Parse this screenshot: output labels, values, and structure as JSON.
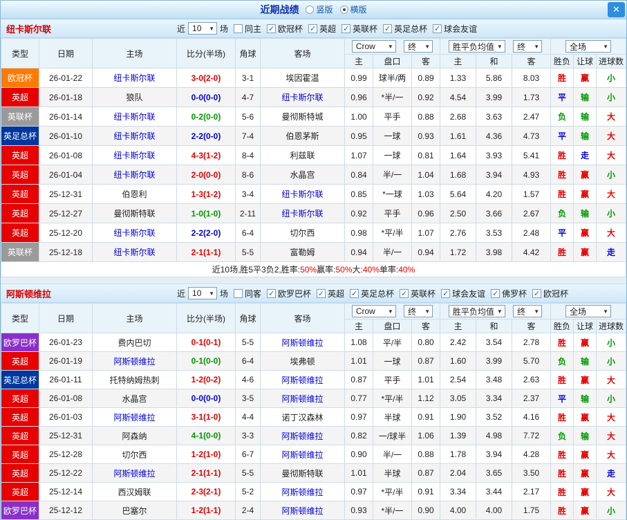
{
  "titlebar": {
    "title": "近期战绩",
    "radio_options": [
      {
        "label": "竖版",
        "selected": false
      },
      {
        "label": "横版",
        "selected": true
      }
    ]
  },
  "icons": {
    "check": "✓",
    "close": "✕",
    "dropdown_arrow": "▼"
  },
  "type_colors": {
    "欧冠杯": "#ff7a00",
    "英超": "#e60000",
    "英联杯": "#9a9a9a",
    "英足总杯": "#00379e",
    "欧罗巴杯": "#8a2fc9"
  },
  "table_header": {
    "cols": [
      "类型",
      "日期",
      "主场",
      "比分(半场)",
      "角球",
      "客场"
    ],
    "sub": [
      "主",
      "盘口",
      "客",
      "主",
      "和",
      "客",
      "胜负",
      "让球",
      "进球数"
    ],
    "bookmaker": "Crow",
    "period": "终",
    "avg_label": "胜平负均值",
    "scope": "全场"
  },
  "sections": [
    {
      "team": "纽卡斯尔联",
      "filter": {
        "near_label": "近",
        "count": "10",
        "games_label": "场",
        "same": {
          "label": "同主",
          "checked": false
        },
        "leagues": [
          {
            "label": "欧冠杯",
            "checked": true
          },
          {
            "label": "英超",
            "checked": true
          },
          {
            "label": "英联杯",
            "checked": true
          },
          {
            "label": "英足总杯",
            "checked": true
          },
          {
            "label": "球会友谊",
            "checked": true
          }
        ]
      },
      "rows": [
        {
          "type": "欧冠杯",
          "date": "26-01-22",
          "home": "纽卡斯尔联",
          "home_focus": true,
          "score": "3-0(2-0)",
          "score_c": "w",
          "corner": "3-1",
          "away": "埃因霍温",
          "away_focus": false,
          "odds": [
            "0.99",
            "球半/两",
            "0.89"
          ],
          "avg": [
            "1.33",
            "5.86",
            "8.03"
          ],
          "res": [
            {
              "t": "胜",
              "c": "w"
            },
            {
              "t": "赢",
              "c": "w"
            },
            {
              "t": "小",
              "c": "l"
            }
          ]
        },
        {
          "type": "英超",
          "date": "26-01-18",
          "home": "狼队",
          "home_focus": false,
          "score": "0-0(0-0)",
          "score_c": "d",
          "corner": "4-7",
          "away": "纽卡斯尔联",
          "away_focus": true,
          "odds": [
            "0.96",
            "*半/一",
            "0.92"
          ],
          "avg": [
            "4.54",
            "3.99",
            "1.73"
          ],
          "res": [
            {
              "t": "平",
              "c": "d"
            },
            {
              "t": "输",
              "c": "l"
            },
            {
              "t": "小",
              "c": "l"
            }
          ]
        },
        {
          "type": "英联杯",
          "date": "26-01-14",
          "home": "纽卡斯尔联",
          "home_focus": true,
          "score": "0-2(0-0)",
          "score_c": "l",
          "corner": "5-6",
          "away": "曼彻斯特城",
          "away_focus": false,
          "odds": [
            "1.00",
            "平手",
            "0.88"
          ],
          "avg": [
            "2.68",
            "3.63",
            "2.47"
          ],
          "res": [
            {
              "t": "负",
              "c": "l"
            },
            {
              "t": "输",
              "c": "l"
            },
            {
              "t": "大",
              "c": "w"
            }
          ]
        },
        {
          "type": "英足总杯",
          "date": "26-01-10",
          "home": "纽卡斯尔联",
          "home_focus": true,
          "score": "2-2(0-0)",
          "score_c": "d",
          "corner": "7-4",
          "away": "伯恩茅斯",
          "away_focus": false,
          "odds": [
            "0.95",
            "一球",
            "0.93"
          ],
          "avg": [
            "1.61",
            "4.36",
            "4.73"
          ],
          "res": [
            {
              "t": "平",
              "c": "d"
            },
            {
              "t": "输",
              "c": "l"
            },
            {
              "t": "大",
              "c": "w"
            }
          ]
        },
        {
          "type": "英超",
          "date": "26-01-08",
          "home": "纽卡斯尔联",
          "home_focus": true,
          "score": "4-3(1-2)",
          "score_c": "w",
          "corner": "8-4",
          "away": "利兹联",
          "away_focus": false,
          "odds": [
            "1.07",
            "一球",
            "0.81"
          ],
          "avg": [
            "1.64",
            "3.93",
            "5.41"
          ],
          "res": [
            {
              "t": "胜",
              "c": "w"
            },
            {
              "t": "走",
              "c": "d"
            },
            {
              "t": "大",
              "c": "w"
            }
          ]
        },
        {
          "type": "英超",
          "date": "26-01-04",
          "home": "纽卡斯尔联",
          "home_focus": true,
          "score": "2-0(0-0)",
          "score_c": "w",
          "corner": "8-6",
          "away": "水晶宫",
          "away_focus": false,
          "odds": [
            "0.84",
            "半/一",
            "1.04"
          ],
          "avg": [
            "1.68",
            "3.94",
            "4.93"
          ],
          "res": [
            {
              "t": "胜",
              "c": "w"
            },
            {
              "t": "赢",
              "c": "w"
            },
            {
              "t": "小",
              "c": "l"
            }
          ]
        },
        {
          "type": "英超",
          "date": "25-12-31",
          "home": "伯恩利",
          "home_focus": false,
          "score": "1-3(1-2)",
          "score_c": "w",
          "corner": "3-4",
          "away": "纽卡斯尔联",
          "away_focus": true,
          "odds": [
            "0.85",
            "*一球",
            "1.03"
          ],
          "avg": [
            "5.64",
            "4.20",
            "1.57"
          ],
          "res": [
            {
              "t": "胜",
              "c": "w"
            },
            {
              "t": "赢",
              "c": "w"
            },
            {
              "t": "大",
              "c": "w"
            }
          ]
        },
        {
          "type": "英超",
          "date": "25-12-27",
          "home": "曼彻斯特联",
          "home_focus": false,
          "score": "1-0(1-0)",
          "score_c": "l",
          "corner": "2-11",
          "away": "纽卡斯尔联",
          "away_focus": true,
          "odds": [
            "0.92",
            "平手",
            "0.96"
          ],
          "avg": [
            "2.50",
            "3.66",
            "2.67"
          ],
          "res": [
            {
              "t": "负",
              "c": "l"
            },
            {
              "t": "输",
              "c": "l"
            },
            {
              "t": "小",
              "c": "l"
            }
          ]
        },
        {
          "type": "英超",
          "date": "25-12-20",
          "home": "纽卡斯尔联",
          "home_focus": true,
          "score": "2-2(2-0)",
          "score_c": "d",
          "corner": "6-4",
          "away": "切尔西",
          "away_focus": false,
          "odds": [
            "0.98",
            "*平/半",
            "1.07"
          ],
          "avg": [
            "2.76",
            "3.53",
            "2.48"
          ],
          "res": [
            {
              "t": "平",
              "c": "d"
            },
            {
              "t": "赢",
              "c": "w"
            },
            {
              "t": "大",
              "c": "w"
            }
          ]
        },
        {
          "type": "英联杯",
          "date": "25-12-18",
          "home": "纽卡斯尔联",
          "home_focus": true,
          "score": "2-1(1-1)",
          "score_c": "w",
          "corner": "5-5",
          "away": "富勒姆",
          "away_focus": false,
          "odds": [
            "0.94",
            "半/一",
            "0.94"
          ],
          "avg": [
            "1.72",
            "3.98",
            "4.42"
          ],
          "res": [
            {
              "t": "胜",
              "c": "w"
            },
            {
              "t": "赢",
              "c": "w"
            },
            {
              "t": "走",
              "c": "d"
            }
          ]
        }
      ],
      "summary": {
        "parts": [
          {
            "t": "近10场,胜5平3负2, ",
            "c": ""
          },
          {
            "t": "胜率:",
            "c": ""
          },
          {
            "t": "50%",
            "c": "w"
          },
          {
            "t": " 赢率:",
            "c": ""
          },
          {
            "t": "50%",
            "c": "w"
          },
          {
            "t": " 大:",
            "c": ""
          },
          {
            "t": "40%",
            "c": "w"
          },
          {
            "t": " 单率:",
            "c": ""
          },
          {
            "t": "40%",
            "c": "w"
          }
        ]
      }
    },
    {
      "team": "阿斯顿维拉",
      "filter": {
        "near_label": "近",
        "count": "10",
        "games_label": "场",
        "same": {
          "label": "同客",
          "checked": false
        },
        "leagues": [
          {
            "label": "欧罗巴杯",
            "checked": true
          },
          {
            "label": "英超",
            "checked": true
          },
          {
            "label": "英足总杯",
            "checked": true
          },
          {
            "label": "英联杯",
            "checked": true
          },
          {
            "label": "球会友谊",
            "checked": true
          },
          {
            "label": "佛罗杯",
            "checked": true
          },
          {
            "label": "欧冠杯",
            "checked": true
          }
        ]
      },
      "rows": [
        {
          "type": "欧罗巴杯",
          "date": "26-01-23",
          "home": "费内巴切",
          "home_focus": false,
          "score": "0-1(0-1)",
          "score_c": "w",
          "corner": "5-5",
          "away": "阿斯顿维拉",
          "away_focus": true,
          "odds": [
            "1.08",
            "平/半",
            "0.80"
          ],
          "avg": [
            "2.42",
            "3.54",
            "2.78"
          ],
          "res": [
            {
              "t": "胜",
              "c": "w"
            },
            {
              "t": "赢",
              "c": "w"
            },
            {
              "t": "小",
              "c": "l"
            }
          ]
        },
        {
          "type": "英超",
          "date": "26-01-19",
          "home": "阿斯顿维拉",
          "home_focus": true,
          "score": "0-1(0-0)",
          "score_c": "l",
          "corner": "6-4",
          "away": "埃弗顿",
          "away_focus": false,
          "odds": [
            "1.01",
            "一球",
            "0.87"
          ],
          "avg": [
            "1.60",
            "3.99",
            "5.70"
          ],
          "res": [
            {
              "t": "负",
              "c": "l"
            },
            {
              "t": "输",
              "c": "l"
            },
            {
              "t": "小",
              "c": "l"
            }
          ]
        },
        {
          "type": "英足总杯",
          "date": "26-01-11",
          "home": "托特纳姆热刺",
          "home_focus": false,
          "score": "1-2(0-2)",
          "score_c": "w",
          "corner": "4-6",
          "away": "阿斯顿维拉",
          "away_focus": true,
          "odds": [
            "0.87",
            "平手",
            "1.01"
          ],
          "avg": [
            "2.54",
            "3.48",
            "2.63"
          ],
          "res": [
            {
              "t": "胜",
              "c": "w"
            },
            {
              "t": "赢",
              "c": "w"
            },
            {
              "t": "大",
              "c": "w"
            }
          ]
        },
        {
          "type": "英超",
          "date": "26-01-08",
          "home": "水晶宫",
          "home_focus": false,
          "score": "0-0(0-0)",
          "score_c": "d",
          "corner": "3-5",
          "away": "阿斯顿维拉",
          "away_focus": true,
          "odds": [
            "0.77",
            "*平/半",
            "1.12"
          ],
          "avg": [
            "3.05",
            "3.34",
            "2.37"
          ],
          "res": [
            {
              "t": "平",
              "c": "d"
            },
            {
              "t": "输",
              "c": "l"
            },
            {
              "t": "小",
              "c": "l"
            }
          ]
        },
        {
          "type": "英超",
          "date": "26-01-03",
          "home": "阿斯顿维拉",
          "home_focus": true,
          "score": "3-1(1-0)",
          "score_c": "w",
          "corner": "4-4",
          "away": "诺丁汉森林",
          "away_focus": false,
          "odds": [
            "0.97",
            "半球",
            "0.91"
          ],
          "avg": [
            "1.90",
            "3.52",
            "4.16"
          ],
          "res": [
            {
              "t": "胜",
              "c": "w"
            },
            {
              "t": "赢",
              "c": "w"
            },
            {
              "t": "大",
              "c": "w"
            }
          ]
        },
        {
          "type": "英超",
          "date": "25-12-31",
          "home": "阿森纳",
          "home_focus": false,
          "score": "4-1(0-0)",
          "score_c": "l",
          "corner": "3-3",
          "away": "阿斯顿维拉",
          "away_focus": true,
          "odds": [
            "0.82",
            "一/球半",
            "1.06"
          ],
          "avg": [
            "1.39",
            "4.98",
            "7.72"
          ],
          "res": [
            {
              "t": "负",
              "c": "l"
            },
            {
              "t": "输",
              "c": "l"
            },
            {
              "t": "大",
              "c": "w"
            }
          ]
        },
        {
          "type": "英超",
          "date": "25-12-28",
          "home": "切尔西",
          "home_focus": false,
          "score": "1-2(1-0)",
          "score_c": "w",
          "corner": "6-7",
          "away": "阿斯顿维拉",
          "away_focus": true,
          "odds": [
            "0.90",
            "半/一",
            "0.88"
          ],
          "avg": [
            "1.78",
            "3.94",
            "4.28"
          ],
          "res": [
            {
              "t": "胜",
              "c": "w"
            },
            {
              "t": "赢",
              "c": "w"
            },
            {
              "t": "大",
              "c": "w"
            }
          ]
        },
        {
          "type": "英超",
          "date": "25-12-22",
          "home": "阿斯顿维拉",
          "home_focus": true,
          "score": "2-1(1-1)",
          "score_c": "w",
          "corner": "5-5",
          "away": "曼彻斯特联",
          "away_focus": false,
          "odds": [
            "1.01",
            "半球",
            "0.87"
          ],
          "avg": [
            "2.04",
            "3.65",
            "3.50"
          ],
          "res": [
            {
              "t": "胜",
              "c": "w"
            },
            {
              "t": "赢",
              "c": "w"
            },
            {
              "t": "走",
              "c": "d"
            }
          ]
        },
        {
          "type": "英超",
          "date": "25-12-14",
          "home": "西汉姆联",
          "home_focus": false,
          "score": "2-3(2-1)",
          "score_c": "w",
          "corner": "5-2",
          "away": "阿斯顿维拉",
          "away_focus": true,
          "odds": [
            "0.97",
            "*平/半",
            "0.91"
          ],
          "avg": [
            "3.34",
            "3.44",
            "2.17"
          ],
          "res": [
            {
              "t": "胜",
              "c": "w"
            },
            {
              "t": "赢",
              "c": "w"
            },
            {
              "t": "大",
              "c": "w"
            }
          ]
        },
        {
          "type": "欧罗巴杯",
          "date": "25-12-12",
          "home": "巴塞尔",
          "home_focus": false,
          "score": "1-2(1-1)",
          "score_c": "w",
          "corner": "2-4",
          "away": "阿斯顿维拉",
          "away_focus": true,
          "odds": [
            "0.93",
            "*半/一",
            "0.90"
          ],
          "avg": [
            "4.00",
            "4.00",
            "1.75"
          ],
          "res": [
            {
              "t": "胜",
              "c": "w"
            },
            {
              "t": "赢",
              "c": "w"
            },
            {
              "t": "小",
              "c": "l"
            }
          ]
        }
      ]
    }
  ]
}
